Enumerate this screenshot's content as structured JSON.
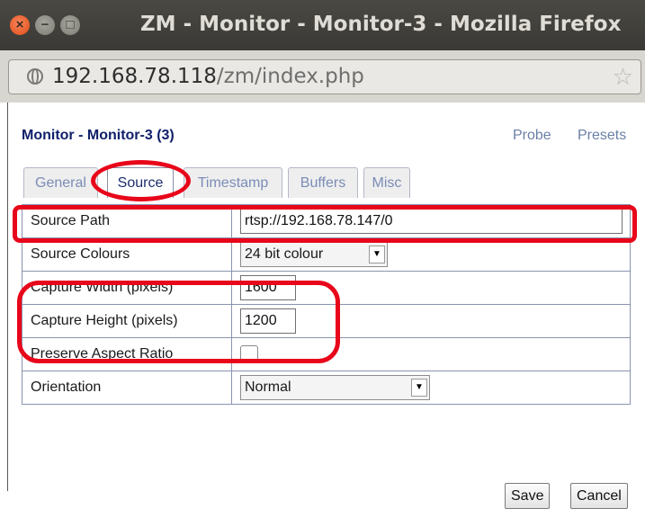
{
  "window": {
    "title": "ZM - Monitor - Monitor-3 - Mozilla Firefox",
    "close_glyph": "×",
    "min_glyph": "−",
    "max_glyph": "□"
  },
  "urlbar": {
    "host": "192.168.78.118",
    "path": "/zm/index.php"
  },
  "page": {
    "heading": "Monitor - Monitor-3 (3)",
    "links": {
      "probe": "Probe",
      "presets": "Presets"
    },
    "tabs": [
      "General",
      "Source",
      "Timestamp",
      "Buffers",
      "Misc"
    ],
    "active_tab": "Source",
    "fields": {
      "source_path": {
        "label": "Source Path",
        "value": "rtsp://192.168.78.147/0"
      },
      "source_colours": {
        "label": "Source Colours",
        "value": "24 bit colour"
      },
      "capture_width": {
        "label": "Capture Width (pixels)",
        "value": "1600"
      },
      "capture_height": {
        "label": "Capture Height (pixels)",
        "value": "1200"
      },
      "preserve_aspect": {
        "label": "Preserve Aspect Ratio",
        "checked": false
      },
      "orientation": {
        "label": "Orientation",
        "value": "Normal"
      }
    },
    "buttons": {
      "save": "Save",
      "cancel": "Cancel"
    }
  },
  "colors": {
    "annotation": "#e8061a",
    "heading": "#10206a",
    "link": "#6b7fa6",
    "titlebar": "#3c3b37"
  }
}
